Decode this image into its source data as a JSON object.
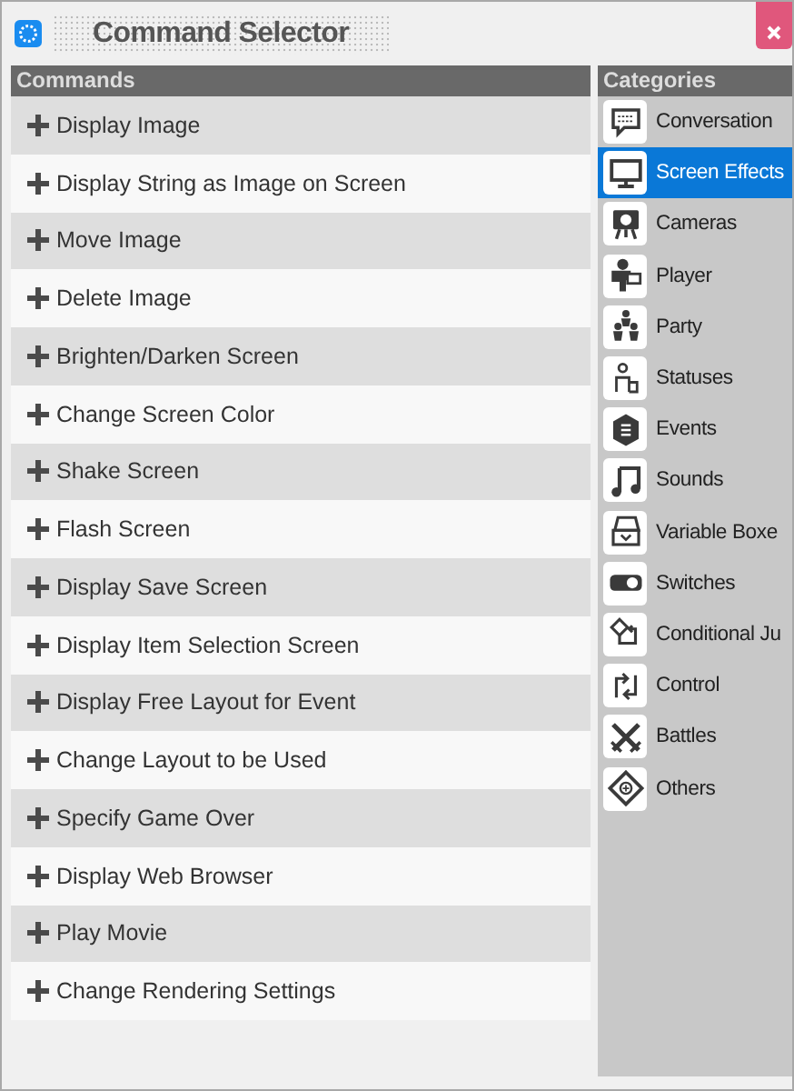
{
  "window": {
    "title": "Command Selector"
  },
  "commands": {
    "title": "Commands",
    "items": [
      {
        "label": "Display Image"
      },
      {
        "label": "Display String as Image on Screen"
      },
      {
        "label": "Move Image"
      },
      {
        "label": "Delete Image"
      },
      {
        "label": "Brighten/Darken Screen"
      },
      {
        "label": "Change Screen Color"
      },
      {
        "label": "Shake Screen"
      },
      {
        "label": "Flash Screen"
      },
      {
        "label": "Display Save Screen"
      },
      {
        "label": "Display Item Selection Screen"
      },
      {
        "label": "Display Free Layout for Event"
      },
      {
        "label": "Change Layout to be Used"
      },
      {
        "label": "Specify Game Over"
      },
      {
        "label": "Display Web Browser"
      },
      {
        "label": "Play Movie"
      },
      {
        "label": "Change Rendering Settings"
      }
    ]
  },
  "categories": {
    "title": "Categories",
    "items": [
      {
        "label": "Conversation",
        "selected": false
      },
      {
        "label": "Screen Effects",
        "selected": true
      },
      {
        "label": "Cameras",
        "selected": false
      },
      {
        "label": "Player",
        "selected": false
      },
      {
        "label": "Party",
        "selected": false
      },
      {
        "label": "Statuses",
        "selected": false
      },
      {
        "label": "Events",
        "selected": false
      },
      {
        "label": "Sounds",
        "selected": false
      },
      {
        "label": "Variable Boxe",
        "selected": false
      },
      {
        "label": "Switches",
        "selected": false
      },
      {
        "label": "Conditional Ju",
        "selected": false
      },
      {
        "label": "Control",
        "selected": false
      },
      {
        "label": "Battles",
        "selected": false
      },
      {
        "label": "Others",
        "selected": false
      }
    ]
  }
}
